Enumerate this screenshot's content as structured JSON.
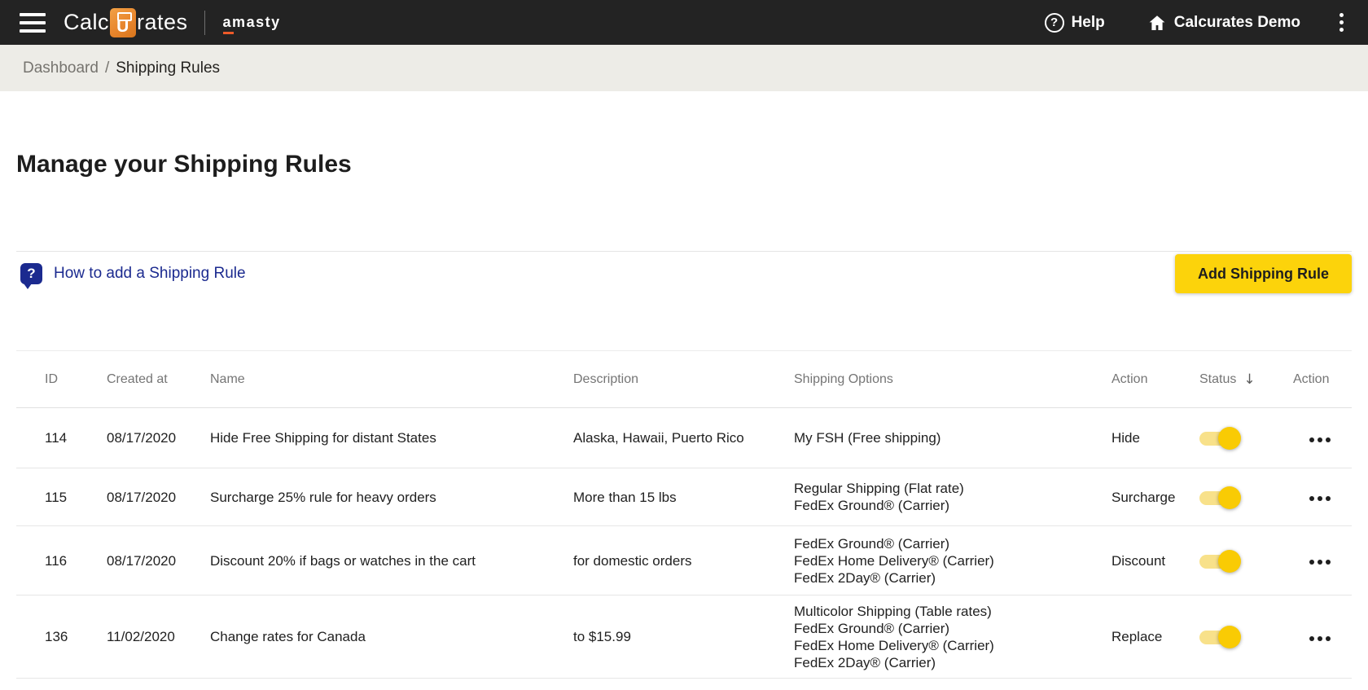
{
  "colors": {
    "header_bg": "#232323",
    "breadcrumb_bg": "#edece7",
    "accent_yellow": "#fcd30b",
    "link_indigo": "#1b2a8f",
    "toggle_track": "#f8e18a",
    "toggle_knob": "#f9cb04",
    "logo_orange": "#e8862d"
  },
  "header": {
    "logo_part1": "Calc",
    "logo_u": "U",
    "logo_part2": "rates",
    "partner_logo": "amasty",
    "help_label": "Help",
    "account_label": "Calcurates Demo"
  },
  "breadcrumb": {
    "parent": "Dashboard",
    "separator": "/",
    "current": "Shipping Rules"
  },
  "page": {
    "title": "Manage your Shipping Rules"
  },
  "toolbar": {
    "howto_icon": "?",
    "howto_link": "How to add a Shipping Rule",
    "add_button": "Add Shipping Rule"
  },
  "table": {
    "columns": [
      "ID",
      "Created at",
      "Name",
      "Description",
      "Shipping Options",
      "Action",
      "Status",
      "Action"
    ],
    "sort_column": "Status",
    "sort_direction": "descending",
    "rows": [
      {
        "id": "114",
        "created_at": "08/17/2020",
        "name": "Hide Free Shipping for distant States",
        "description": "Alaska, Hawaii, Puerto Rico",
        "shipping_options": [
          "My FSH (Free shipping)"
        ],
        "action": "Hide",
        "status_on": true
      },
      {
        "id": "115",
        "created_at": "08/17/2020",
        "name": "Surcharge 25% rule for heavy orders",
        "description": "More than 15 lbs",
        "shipping_options": [
          "Regular Shipping (Flat rate)",
          "FedEx Ground® (Carrier)"
        ],
        "action": "Surcharge",
        "status_on": true
      },
      {
        "id": "116",
        "created_at": "08/17/2020",
        "name": "Discount 20% if bags or watches in the cart",
        "description": "for domestic orders",
        "shipping_options": [
          "FedEx Ground® (Carrier)",
          "FedEx Home Delivery® (Carrier)",
          "FedEx 2Day® (Carrier)"
        ],
        "action": "Discount",
        "status_on": true
      },
      {
        "id": "136",
        "created_at": "11/02/2020",
        "name": "Change rates for Canada",
        "description": "to $15.99",
        "shipping_options": [
          "Multicolor Shipping (Table rates)",
          "FedEx Ground® (Carrier)",
          "FedEx Home Delivery® (Carrier)",
          "FedEx 2Day® (Carrier)"
        ],
        "action": "Replace",
        "status_on": true
      }
    ]
  }
}
